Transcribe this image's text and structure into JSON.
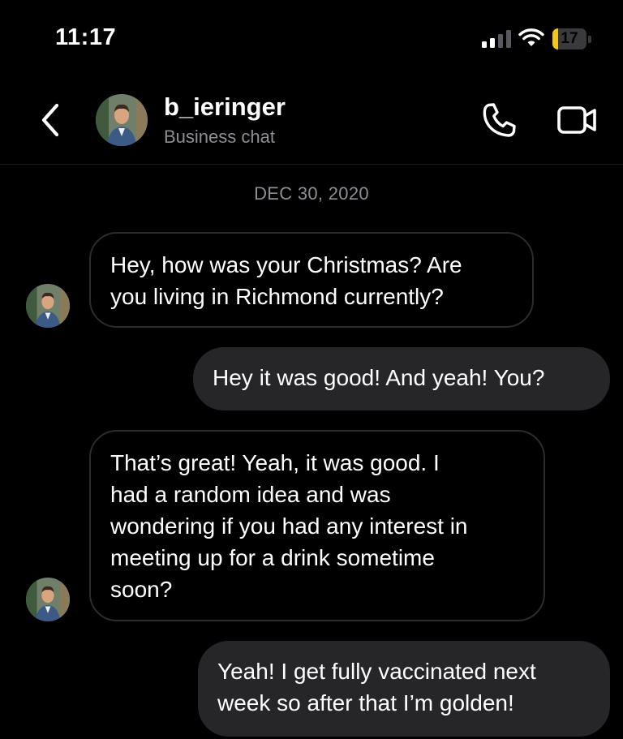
{
  "status_bar": {
    "time": "11:17",
    "battery_level": "17",
    "battery_fraction": 0.17,
    "battery_color": "#f5c518",
    "signal_icon": "cellular-signal-icon",
    "wifi_icon": "wifi-icon"
  },
  "header": {
    "back_icon": "chevron-left-icon",
    "contact_name": "b_ieringer",
    "subtitle": "Business chat",
    "call_icon": "phone-icon",
    "video_icon": "video-camera-icon"
  },
  "conversation": {
    "date_separator": "DEC 30, 2020",
    "messages": [
      {
        "direction": "incoming",
        "lines": [
          "Hey, how was your Christmas? Are",
          "you living in Richmond currently?"
        ]
      },
      {
        "direction": "outgoing",
        "lines": [
          "Hey it was good! And yeah! You?"
        ]
      },
      {
        "direction": "incoming",
        "lines": [
          "That’s great! Yeah, it was good. I",
          "had a random idea and was",
          "wondering if you had any interest in",
          "meeting up for a drink sometime",
          "soon?"
        ]
      },
      {
        "direction": "outgoing",
        "lines": [
          "Yeah! I get fully vaccinated next",
          "week so after that I’m golden!"
        ]
      }
    ]
  },
  "colors": {
    "background": "#000000",
    "outgoing_bubble": "#262628",
    "incoming_border": "#2c2c2e",
    "secondary_text": "#8e8e93"
  }
}
